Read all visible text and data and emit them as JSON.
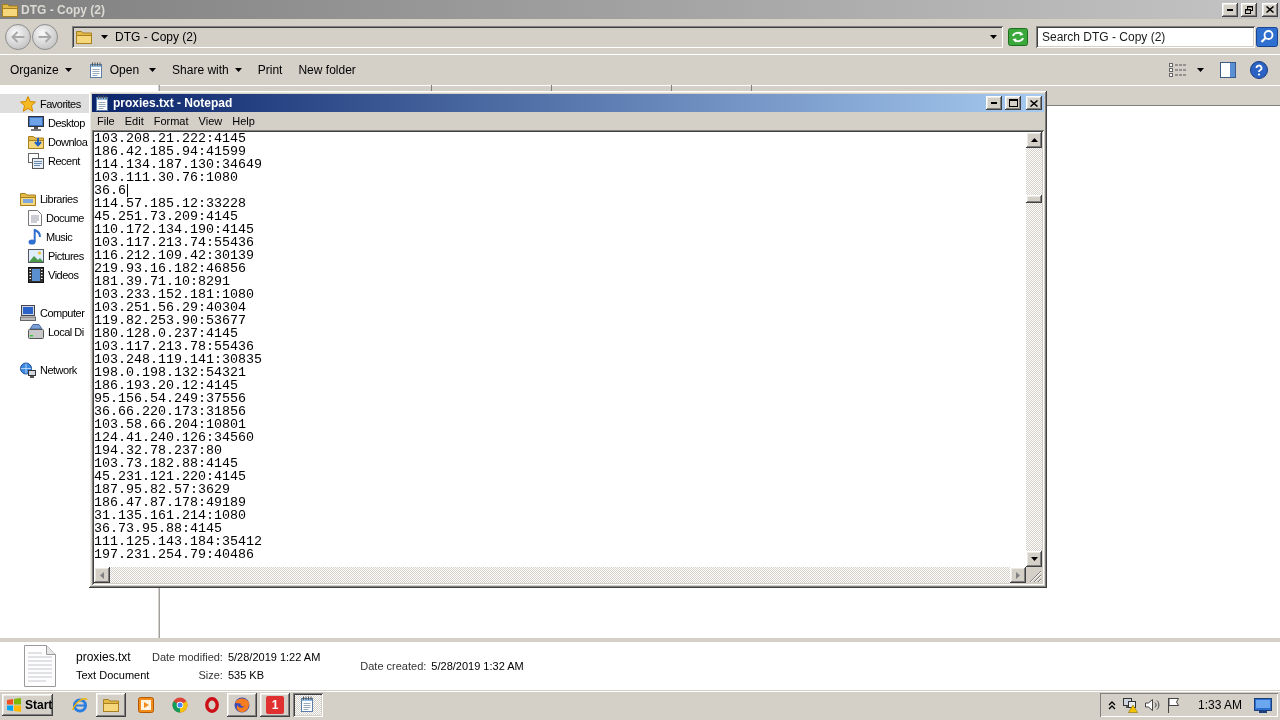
{
  "explorer": {
    "title": "DTG - Copy (2)",
    "active": false,
    "maximized": true,
    "address": {
      "path": "DTG - Copy (2)"
    },
    "search": {
      "placeholder": "Search DTG - Copy (2)"
    },
    "toolbar": [
      {
        "label": "Organize",
        "kind": "dropdown"
      },
      {
        "label": "Open",
        "kind": "app-dropdown"
      },
      {
        "label": "Share with",
        "kind": "dropdown"
      },
      {
        "label": "Print",
        "kind": "command"
      },
      {
        "label": "New folder",
        "kind": "command"
      }
    ],
    "nav": [
      {
        "label": "Favorites",
        "selected": true,
        "children": [
          {
            "label": "Desktop",
            "selected": false
          },
          {
            "label": "Downloa",
            "selected": false
          },
          {
            "label": "Recent",
            "selected": false
          }
        ]
      },
      {
        "label": "Libraries",
        "selected": false,
        "children": [
          {
            "label": "Docume",
            "selected": false
          },
          {
            "label": "Music",
            "selected": false
          },
          {
            "label": "Pictures",
            "selected": false
          },
          {
            "label": "Videos",
            "selected": false
          }
        ]
      },
      {
        "label": "Computer",
        "selected": false,
        "children": [
          {
            "label": "Local Di",
            "selected": false
          }
        ]
      },
      {
        "label": "Network",
        "selected": false
      }
    ],
    "details": {
      "file_name": "proxies.txt",
      "file_type": "Text Document",
      "columns": [
        [
          {
            "label": "Date modified:",
            "value": "5/28/2019 1:22 AM"
          },
          {
            "label": "Size:",
            "value": "535 KB"
          }
        ],
        [
          {
            "label": "Date created:",
            "value": "5/28/2019 1:32 AM"
          }
        ]
      ]
    }
  },
  "notepad": {
    "title": "proxies.txt - Notepad",
    "active": true,
    "maximized": false,
    "menu": [
      "File",
      "Edit",
      "Format",
      "View",
      "Help"
    ],
    "lines": [
      {
        "text": "103.208.21.222:4145",
        "caret": false
      },
      {
        "text": "186.42.185.94:41599",
        "caret": false
      },
      {
        "text": "114.134.187.130:34649",
        "caret": false
      },
      {
        "text": "103.111.30.76:1080",
        "caret": false
      },
      {
        "text": "36.6",
        "caret": true
      },
      {
        "text": "114.57.185.12:33228",
        "caret": false
      },
      {
        "text": "45.251.73.209:4145",
        "caret": false
      },
      {
        "text": "110.172.134.190:4145",
        "caret": false
      },
      {
        "text": "103.117.213.74:55436",
        "caret": false
      },
      {
        "text": "116.212.109.42:30139",
        "caret": false
      },
      {
        "text": "219.93.16.182:46856",
        "caret": false
      },
      {
        "text": "181.39.71.10:8291",
        "caret": false
      },
      {
        "text": "103.233.152.181:1080",
        "caret": false
      },
      {
        "text": "103.251.56.29:40304",
        "caret": false
      },
      {
        "text": "119.82.253.90:53677",
        "caret": false
      },
      {
        "text": "180.128.0.237:4145",
        "caret": false
      },
      {
        "text": "103.117.213.78:55436",
        "caret": false
      },
      {
        "text": "103.248.119.141:30835",
        "caret": false
      },
      {
        "text": "198.0.198.132:54321",
        "caret": false
      },
      {
        "text": "186.193.20.12:4145",
        "caret": false
      },
      {
        "text": "95.156.54.249:37556",
        "caret": false
      },
      {
        "text": "36.66.220.173:31856",
        "caret": false
      },
      {
        "text": "103.58.66.204:10801",
        "caret": false
      },
      {
        "text": "124.41.240.126:34560",
        "caret": false
      },
      {
        "text": "194.32.78.237:80",
        "caret": false
      },
      {
        "text": "103.73.182.88:4145",
        "caret": false
      },
      {
        "text": "45.231.121.220:4145",
        "caret": false
      },
      {
        "text": "187.95.82.57:3629",
        "caret": false
      },
      {
        "text": "186.47.87.178:49189",
        "caret": false
      },
      {
        "text": "31.135.161.214:1080",
        "caret": false
      },
      {
        "text": "36.73.95.88:4145",
        "caret": false
      },
      {
        "text": "111.125.143.184:35412",
        "caret": false
      },
      {
        "text": "197.231.254.79:40486",
        "caret": false
      }
    ]
  },
  "taskbar": {
    "start": "Start",
    "apps": [
      {
        "selected": false
      },
      {
        "selected": false
      },
      {
        "selected": false,
        "label": "1"
      },
      {
        "selected": true
      }
    ],
    "clock": "1:33 AM"
  }
}
